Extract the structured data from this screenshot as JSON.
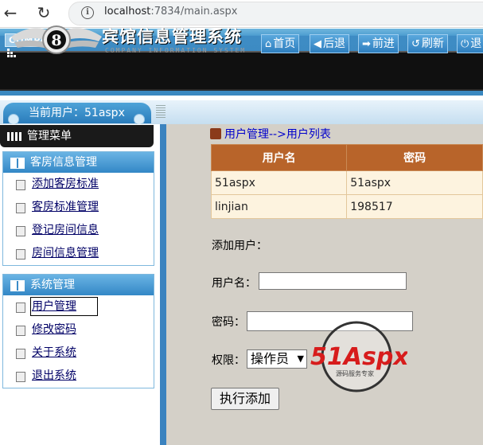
{
  "browser": {
    "url_host": "localhost",
    "url_rest": ":7834/main.aspx"
  },
  "header": {
    "company": "COMPANY",
    "system_title": "宾馆信息管理系统",
    "system_subtitle": "COMPANY INFORMATION SYSTEM",
    "emblem_letter": "8",
    "nav_buttons": [
      {
        "label": "首页",
        "icon": "home-icon"
      },
      {
        "label": "后退",
        "icon": "back-arrow-icon"
      },
      {
        "label": "前进",
        "icon": "forward-arrow-icon"
      },
      {
        "label": "刷新",
        "icon": "refresh-icon"
      },
      {
        "label": "退",
        "icon": "power-icon"
      }
    ]
  },
  "userbar": {
    "current_user_label": "当前用户：51aspx"
  },
  "sidebar": {
    "menu_title": "管理菜单",
    "sections": [
      {
        "title": "客房信息管理",
        "items": [
          "添加客房标准",
          "客房标准管理",
          "登记房间信息",
          "房间信息管理"
        ]
      },
      {
        "title": "系统管理",
        "items": [
          "用户管理",
          "修改密码",
          "关于系统",
          "退出系统"
        ]
      }
    ]
  },
  "main": {
    "breadcrumb": "用户管理-->用户列表",
    "table": {
      "columns": [
        "用户名",
        "密码"
      ],
      "rows": [
        [
          "51aspx",
          "51aspx"
        ],
        [
          "linjian",
          "198517"
        ]
      ]
    },
    "form": {
      "heading": "添加用户：",
      "username_label": "用户名：",
      "username_value": "",
      "password_label": "密码：",
      "password_value": "",
      "role_label": "权限：",
      "role_selected": "操作员",
      "submit_label": "执行添加"
    }
  },
  "watermark": {
    "brand": "51Aspx",
    "tagline": "源码服务专家"
  },
  "colors": {
    "header_blue": "#3a88c0",
    "table_header": "#b8642a",
    "content_bg": "#d4d0c8",
    "link": "#000066"
  }
}
